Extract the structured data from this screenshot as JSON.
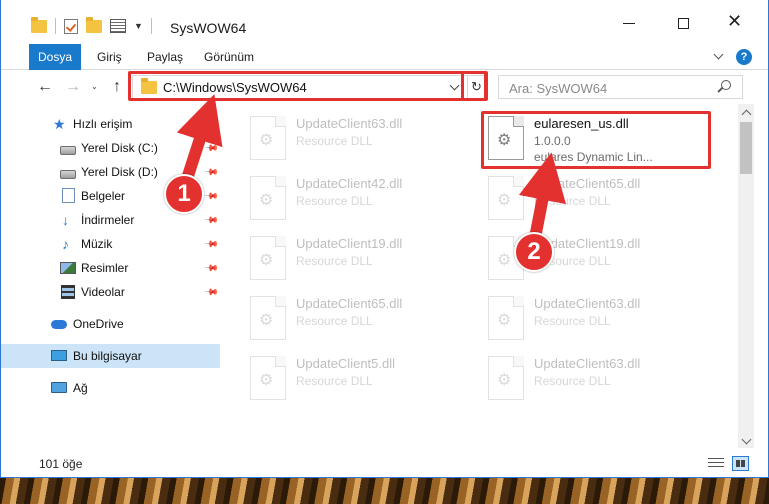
{
  "window": {
    "title": "SysWOW64",
    "close_glyph": "✕"
  },
  "ribbon": {
    "tabs": [
      "Dosya",
      "Giriş",
      "Paylaş",
      "Görünüm"
    ],
    "help_glyph": "?"
  },
  "navigation": {
    "back_glyph": "←",
    "forward_glyph": "→",
    "recent_glyph": "⌄",
    "up_glyph": "↑",
    "address_path": "C:\\Windows\\SysWOW64",
    "refresh_glyph": "↻",
    "search_placeholder": "Ara: SysWOW64"
  },
  "sidebar": {
    "items": [
      {
        "label": "Hızlı erişim",
        "icon": "star-icon",
        "glyph": "★"
      },
      {
        "label": "Yerel Disk (C:)",
        "icon": "drive-icon"
      },
      {
        "label": "Yerel Disk (D:)",
        "icon": "drive-icon"
      },
      {
        "label": "Belgeler",
        "icon": "documents-icon"
      },
      {
        "label": "İndirmeler",
        "icon": "download-icon",
        "glyph": "↓"
      },
      {
        "label": "Müzik",
        "icon": "music-icon",
        "glyph": "♪"
      },
      {
        "label": "Resimler",
        "icon": "pictures-icon"
      },
      {
        "label": "Videolar",
        "icon": "videos-icon"
      },
      {
        "label": "OneDrive",
        "icon": "cloud-icon"
      },
      {
        "label": "Bu bilgisayar",
        "icon": "computer-icon"
      },
      {
        "label": "Ağ",
        "icon": "network-icon"
      }
    ],
    "pin_glyph": "📌"
  },
  "files": {
    "gear_glyph": "⚙",
    "highlighted": {
      "name": "eularesen_us.dll",
      "version": "1.0.0.0",
      "description": "eulares Dynamic Lin..."
    },
    "background_files": [
      {
        "name": "UpdateClient63.dll",
        "desc": "Resource DLL"
      },
      {
        "name": "UpdateClient42.dll",
        "desc": "Resource DLL"
      },
      {
        "name": "UpdateClient65.dll",
        "desc": "Resource DLL"
      },
      {
        "name": "UpdateClient19.dll",
        "desc": "Resource DLL"
      },
      {
        "name": "UpdateClient19.dll",
        "desc": "Resource DLL"
      },
      {
        "name": "UpdateClient65.dll",
        "desc": "Resource DLL"
      },
      {
        "name": "UpdateClient63.dll",
        "desc": "Resource DLL"
      },
      {
        "name": "UpdateClient5.dll",
        "desc": "Resource DLL"
      },
      {
        "name": "UpdateClient63.dll",
        "desc": "Resource DLL"
      }
    ]
  },
  "status": {
    "item_count": "101 öğe"
  },
  "annotations": {
    "step1": "1",
    "step2": "2",
    "color": "#e3312f"
  },
  "colors": {
    "accent": "#1979ca",
    "selection": "#cce4f7",
    "highlight_red": "#e3312f"
  }
}
